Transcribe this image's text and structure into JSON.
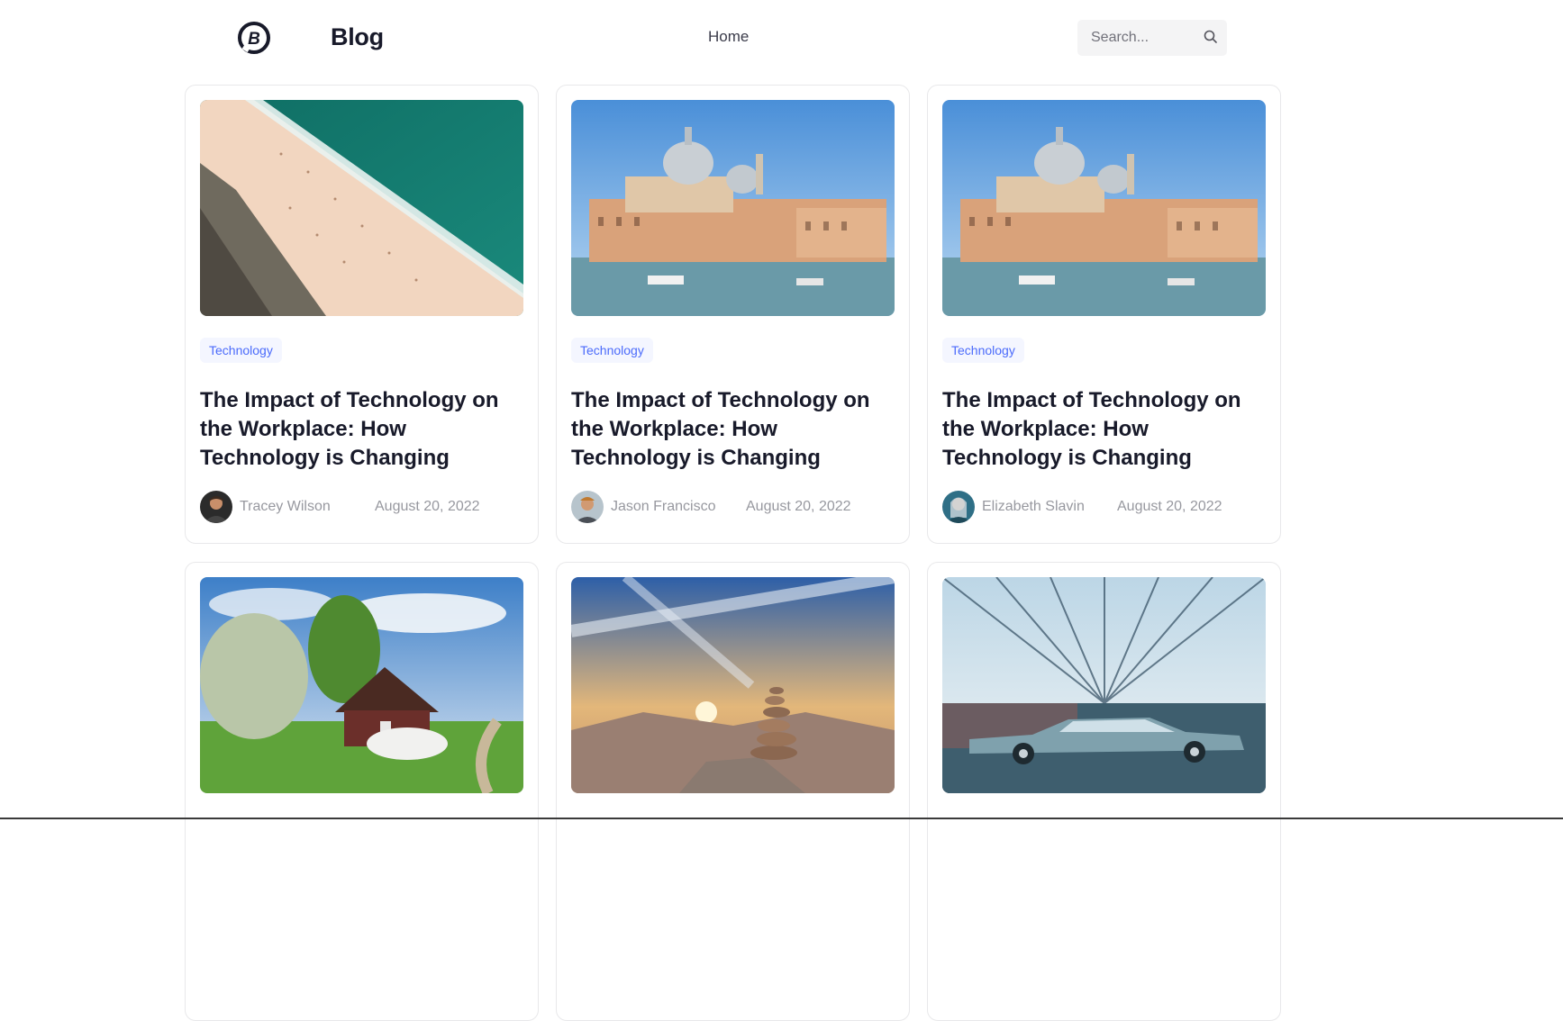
{
  "header": {
    "brand": "Blog",
    "nav_home": "Home",
    "search_placeholder": "Search..."
  },
  "posts": [
    {
      "image": "beach-aerial",
      "tag": "Technology",
      "title": "The Impact of Technology on the Workplace: How Technology is Changing",
      "author": "Tracey Wilson",
      "date": "August 20, 2022"
    },
    {
      "image": "venice-canal",
      "tag": "Technology",
      "title": "The Impact of Technology on the Workplace: How Technology is Changing",
      "author": "Jason Francisco",
      "date": "August 20, 2022"
    },
    {
      "image": "venice-canal",
      "tag": "Technology",
      "title": "The Impact of Technology on the Workplace: How Technology is Changing",
      "author": "Elizabeth Slavin",
      "date": "August 20, 2022"
    },
    {
      "image": "cottage-meadow"
    },
    {
      "image": "stone-cairn-sunset"
    },
    {
      "image": "vintage-car-tunnel"
    }
  ],
  "colors": {
    "accent": "#4b6bfb",
    "tag_bg": "#f4f6ff",
    "title": "#181a2a",
    "meta": "#97989f",
    "card_border": "#e8e8ea"
  }
}
